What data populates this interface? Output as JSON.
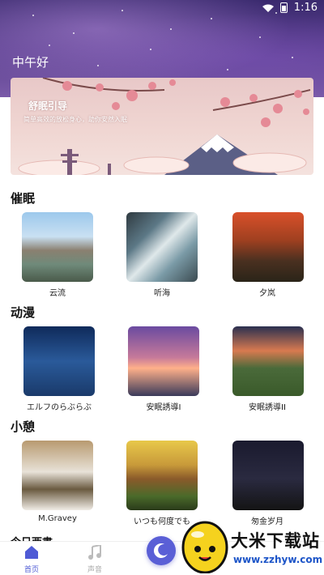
{
  "status_bar": {
    "time": "1:16"
  },
  "header": {
    "greeting": "中午好"
  },
  "banner": {
    "title": "舒眠引导",
    "subtitle": "简单高效的放松身心，助你安然入眠"
  },
  "sections": [
    {
      "title": "催眠",
      "items": [
        {
          "label": "云流"
        },
        {
          "label": "听海"
        },
        {
          "label": "夕岚"
        }
      ]
    },
    {
      "title": "动漫",
      "items": [
        {
          "label": "エルフのらぶらぶ"
        },
        {
          "label": "安眠誘導I"
        },
        {
          "label": "安眠誘導II"
        }
      ]
    },
    {
      "title": "小憩",
      "items": [
        {
          "label": "M.Gravey"
        },
        {
          "label": "いつも何度でも"
        },
        {
          "label": "匆金岁月"
        }
      ]
    }
  ],
  "today": {
    "title": "今日西書"
  },
  "bottom_nav": {
    "items": [
      {
        "label": "首页",
        "icon": "home-icon",
        "active": true
      },
      {
        "label": "声音",
        "icon": "music-note-icon",
        "active": false
      }
    ],
    "center_icon": "moon-icon"
  },
  "watermark": {
    "main": "大米下载站",
    "url": "www.zzhyw.com"
  },
  "colors": {
    "accent": "#5a5fd6",
    "nav_active": "#4f5bd5",
    "nav_inactive": "#aaaaaa"
  }
}
